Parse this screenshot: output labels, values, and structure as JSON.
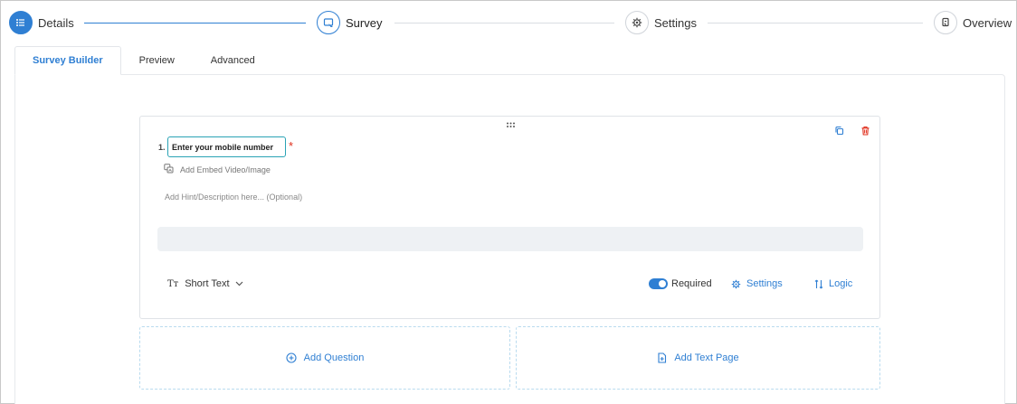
{
  "stepper": {
    "steps": [
      {
        "label": "Details",
        "state": "done"
      },
      {
        "label": "Survey",
        "state": "active"
      },
      {
        "label": "Settings",
        "state": "upcoming"
      },
      {
        "label": "Overview",
        "state": "upcoming"
      }
    ]
  },
  "tabs": [
    {
      "label": "Survey Builder",
      "active": true
    },
    {
      "label": "Preview",
      "active": false
    },
    {
      "label": "Advanced",
      "active": false
    }
  ],
  "question": {
    "number": "1.",
    "title": "Enter your mobile number",
    "required_marker": "*",
    "embed_label": "Add Embed Video/Image",
    "hint_placeholder": "Add Hint/Description here... (Optional)",
    "type_label": "Short Text",
    "required_label": "Required",
    "required_on": true,
    "settings_label": "Settings",
    "logic_label": "Logic"
  },
  "actions": {
    "add_question": "Add Question",
    "add_text_page": "Add Text Page"
  },
  "colors": {
    "accent": "#2f7fd3",
    "danger": "#e0301e",
    "input_border": "#2aa3b5"
  }
}
